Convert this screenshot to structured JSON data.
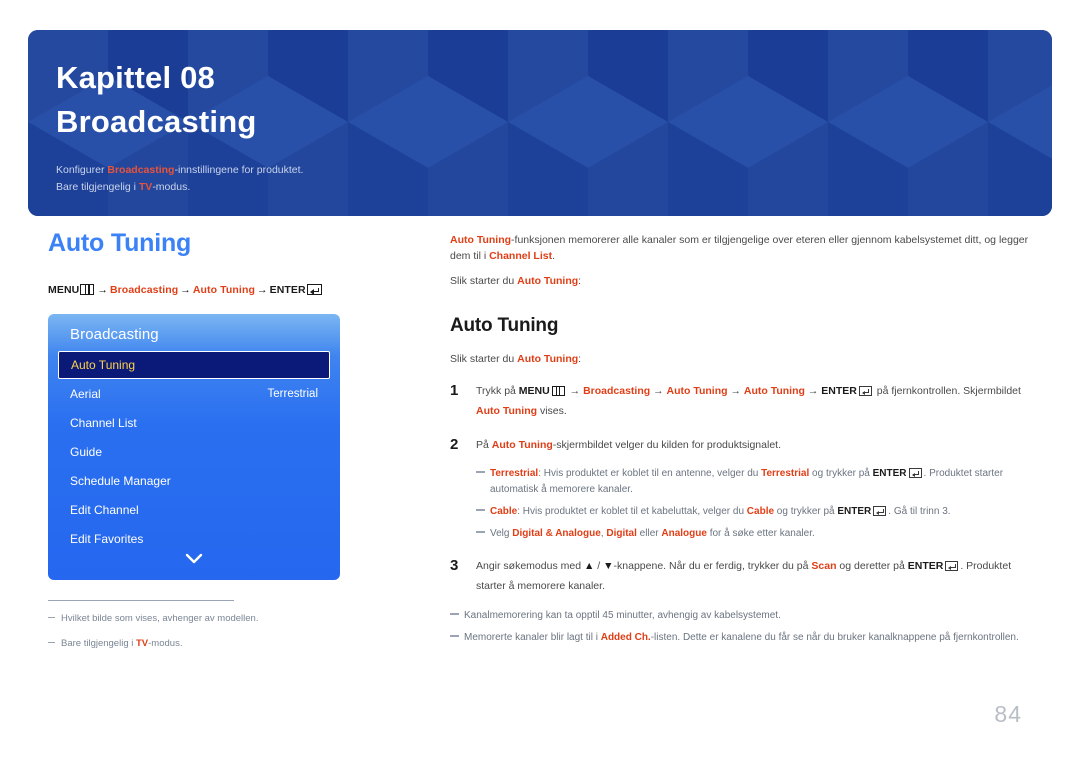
{
  "hero": {
    "chapter": "Kapittel 08",
    "title": "Broadcasting",
    "sub_line1_a": "Konfigurer ",
    "sub_line1_hl": "Broadcasting",
    "sub_line1_b": "-innstillingene for produktet.",
    "sub_line2_a": "Bare tilgjengelig i ",
    "sub_line2_hl": "TV",
    "sub_line2_b": "-modus.",
    "bg_color": "#1e429f",
    "accent_color": "#e8533a"
  },
  "left": {
    "heading": "Auto Tuning",
    "heading_color": "#3b82f6",
    "breadcrumb": {
      "menu_label": "MENU",
      "menu_icon": "menu-bars-icon",
      "arrow": "→",
      "item1": "Broadcasting",
      "item2": "Auto Tuning",
      "enter_label": "ENTER",
      "enter_icon": "enter-return-icon"
    },
    "tv_menu": {
      "title": "Broadcasting",
      "items": [
        {
          "label": "Auto Tuning",
          "value": "",
          "selected": true
        },
        {
          "label": "Aerial",
          "value": "Terrestrial",
          "selected": false
        },
        {
          "label": "Channel List",
          "value": "",
          "selected": false
        },
        {
          "label": "Guide",
          "value": "",
          "selected": false
        },
        {
          "label": "Schedule Manager",
          "value": "",
          "selected": false
        },
        {
          "label": "Edit Channel",
          "value": "",
          "selected": false
        },
        {
          "label": "Edit Favorites",
          "value": "",
          "selected": false
        }
      ],
      "scroll_icon": "chevron-down-icon",
      "selected_text_color": "#ffd24a",
      "selected_bg_color": "#0b1a78"
    },
    "notes": [
      {
        "text": "Hvilket bilde som vises, avhenger av modellen."
      },
      {
        "pre": "Bare tilgjengelig i ",
        "hl": "TV",
        "post": "-modus."
      }
    ]
  },
  "right": {
    "intro": {
      "hl1": "Auto Tuning",
      "t1": "-funksjonen memorerer alle kanaler som er tilgjengelige over eteren eller gjennom kabelsystemet ditt, og legger dem til i ",
      "hl2": "Channel List",
      "t2": ".",
      "line2_pre": "Slik starter du ",
      "line2_hl": "Auto Tuning",
      "line2_post": ":"
    },
    "heading": "Auto Tuning",
    "lead": {
      "pre": "Slik starter du ",
      "hl": "Auto Tuning",
      "post": ":"
    },
    "steps": [
      {
        "num": "1",
        "t1": "Trykk på ",
        "b1": "MENU",
        "icon1": "menu-bars-icon",
        "a1": "→",
        "r1": "Broadcasting",
        "a2": "→",
        "r2": "Auto Tuning",
        "a3": "→",
        "r3": "Auto Tuning",
        "a4": "→",
        "b2": "ENTER",
        "icon2": "enter-return-icon",
        "t2": " på fjernkontrollen. Skjermbildet ",
        "r4": "Auto Tuning",
        "t3": " vises."
      },
      {
        "num": "2",
        "t1": "På ",
        "r1": "Auto Tuning",
        "t2": "-skjermbildet velger du kilden for produktsignalet."
      },
      {
        "num": "3",
        "t1": "Angir søkemodus med ",
        "b1": "▲",
        "sep": " / ",
        "b2": "▼",
        "t2": "-knappene. Når du er ferdig, trykker du på ",
        "r1": "Scan",
        "t3": " og deretter på ",
        "b3": "ENTER",
        "icon1": "enter-return-icon",
        "t4": ". Produktet starter å memorere kanaler."
      }
    ],
    "substeps": [
      {
        "hl1": "Terrestrial",
        "t1": ": Hvis produktet er koblet til en antenne, velger du ",
        "hl2": "Terrestrial",
        "t2": " og trykker på ",
        "b1": "ENTER",
        "icon": "enter-return-icon",
        "t3": ". Produktet starter automatisk å memorere kanaler."
      },
      {
        "hl1": "Cable",
        "t1": ": Hvis produktet er koblet til et kabeluttak, velger du ",
        "hl2": "Cable",
        "t2": " og trykker på ",
        "b1": "ENTER",
        "icon": "enter-return-icon",
        "t3": ". Gå til trinn 3."
      },
      {
        "t0": "Velg ",
        "hl1": "Digital & Analogue",
        "t1": ", ",
        "hl2": "Digital",
        "t2": " eller ",
        "hl3": "Analogue",
        "t3": " for å søke etter kanaler."
      }
    ],
    "notes": [
      {
        "text": "Kanalmemorering kan ta opptil 45 minutter, avhengig av kabelsystemet."
      },
      {
        "pre": "Memorerte kanaler blir lagt til i ",
        "hl": "Added Ch.",
        "post": "-listen. Dette er kanalene du får se når du bruker kanalknappene på fjernkontrollen."
      }
    ]
  },
  "page_number": "84"
}
